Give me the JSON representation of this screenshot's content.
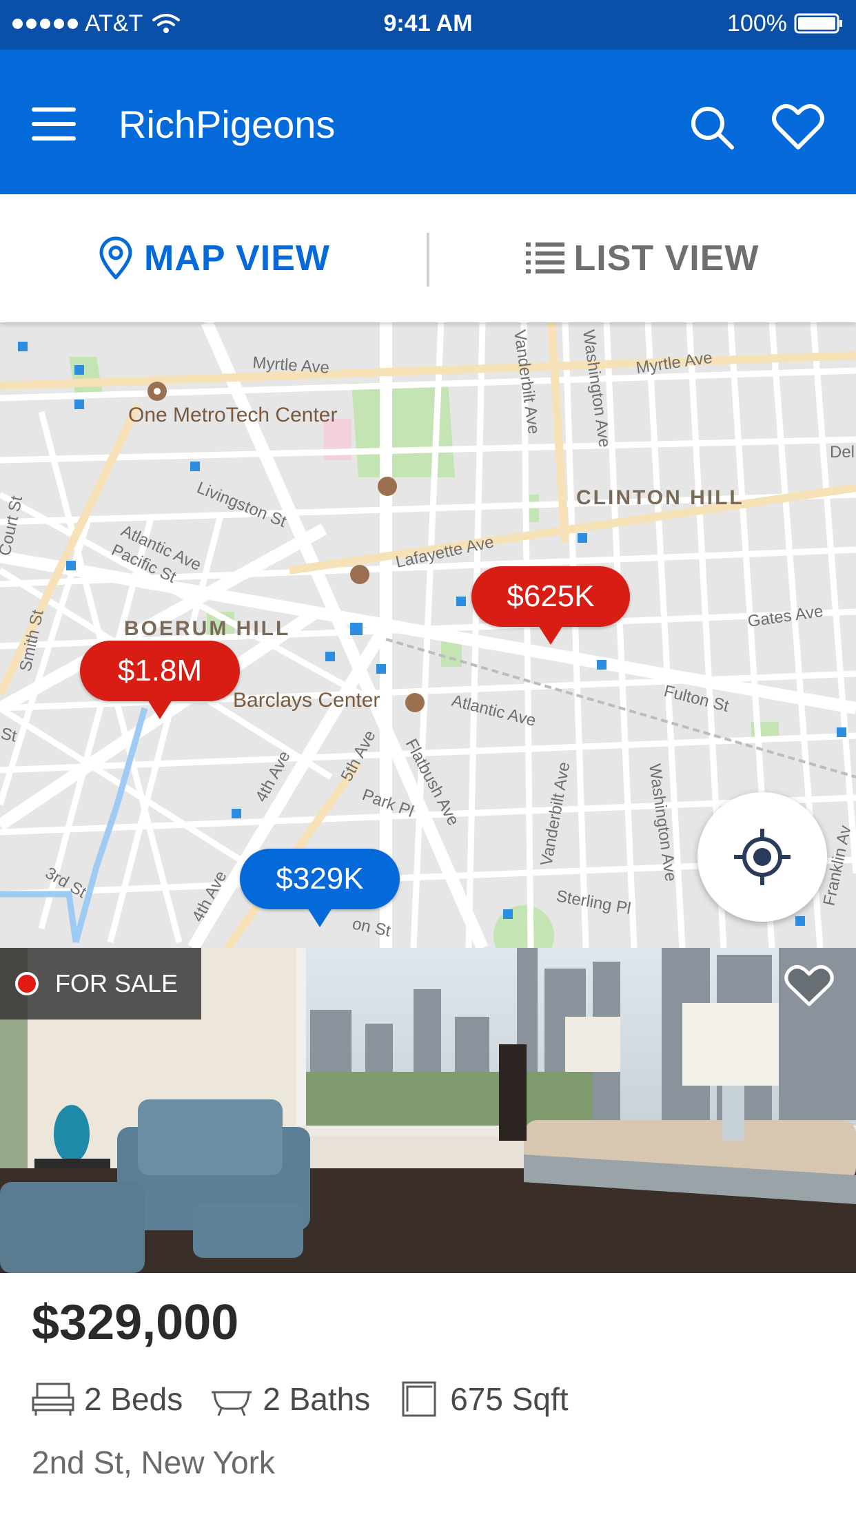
{
  "status_bar": {
    "carrier": "AT&T",
    "time": "9:41 AM",
    "battery": "100%"
  },
  "app_bar": {
    "title": "RichPigeons",
    "icons": [
      "menu-icon",
      "search-icon",
      "heart-icon"
    ]
  },
  "view_toggle": {
    "map_label": "MAP VIEW",
    "list_label": "LIST VIEW",
    "active": "map"
  },
  "map": {
    "labels": {
      "myrtle_ave_1": "Myrtle Ave",
      "myrtle_ave_2": "Myrtle Ave",
      "metrotech": "One MetroTech Center",
      "clinton_hill": "CLINTON HILL",
      "livingston": "Livingston St",
      "atlantic_pacific": "Atlantic Ave",
      "pacific_st": "Pacific St",
      "lafayette": "Lafayette Ave",
      "boerum_hill": "BOERUM HILL",
      "barclays": "Barclays Center",
      "atlantic_ave": "Atlantic Ave",
      "fulton": "Fulton St",
      "gates": "Gates Ave",
      "vanderbilt_1": "Vanderbilt Ave",
      "washington_1": "Washington Ave",
      "vanderbilt_2": "Vanderbilt Ave",
      "washington_2": "Washington Ave",
      "court_st": "Court St",
      "smith_st": "Smith St",
      "fourth_ave_1": "4th Ave",
      "fifth_ave": "5th Ave",
      "flatbush": "Flatbush Ave",
      "park_pl": "Park Pl",
      "third_st": "3rd St",
      "fourth_ave_2": "4th Ave",
      "sterling": "Sterling Pl",
      "franklin": "Franklin Av",
      "del": "Del",
      "st": "St",
      "on_st": "on St"
    },
    "pins": [
      {
        "label": "$625K",
        "color": "#d81e14",
        "selected": false
      },
      {
        "label": "$1.8M",
        "color": "#d81e14",
        "selected": false
      },
      {
        "label": "$329K",
        "color": "#0469d9",
        "selected": true
      }
    ],
    "locate_icon": "crosshair-icon"
  },
  "listing": {
    "status": "FOR SALE",
    "price": "$329,000",
    "beds": "2 Beds",
    "baths": "2 Baths",
    "sqft": "675 Sqft",
    "address": "2nd St, New York",
    "favorite_icon": "heart-outline-icon"
  },
  "colors": {
    "brand_blue": "#0469d9",
    "status_bar_blue": "#0a4fa8",
    "pin_red": "#d81e14"
  }
}
